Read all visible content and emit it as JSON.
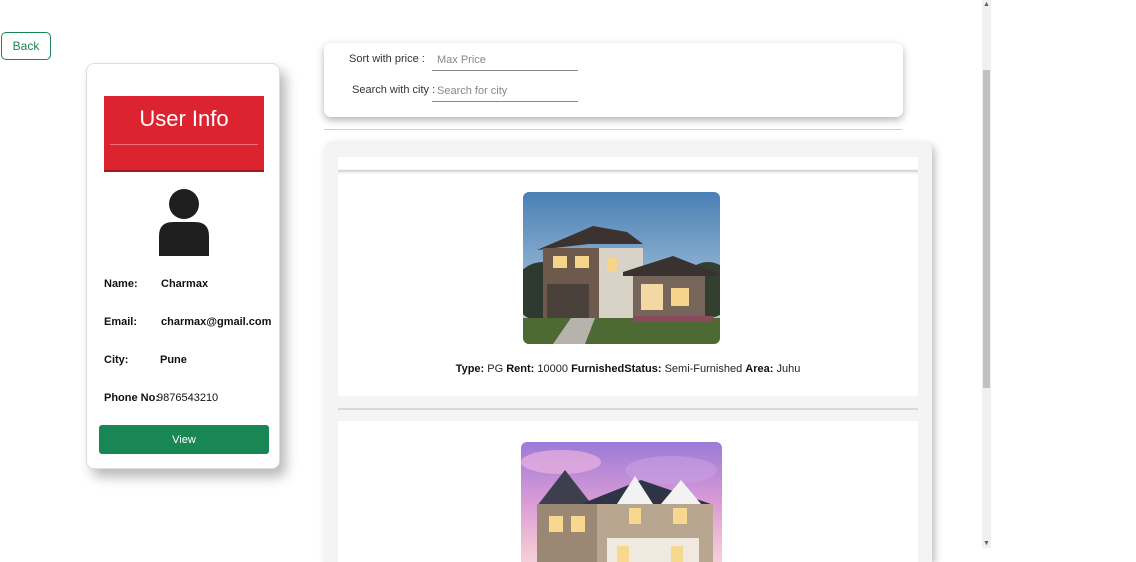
{
  "back_button": {
    "label": "Back"
  },
  "user_card": {
    "title": "User Info",
    "fields": [
      {
        "label": "Name:",
        "value": "Charmax"
      },
      {
        "label": "Email:",
        "value": "charmax@gmail.com"
      },
      {
        "label": "City:",
        "value": "Pune"
      },
      {
        "label": "Phone No:",
        "value": "9876543210"
      }
    ],
    "view_button": "View"
  },
  "filters": {
    "price_label": "Sort with price :",
    "price_placeholder": "Max Price",
    "city_label": "Search with city :",
    "city_placeholder": "Search for city"
  },
  "listings": [
    {
      "type_label": "Type:",
      "type": "PG",
      "rent_label": "Rent:",
      "rent": "10000",
      "furnished_label": "FurnishedStatus:",
      "furnished": "Semi-Furnished",
      "area_label": "Area:",
      "area": "Juhu"
    },
    {}
  ],
  "colors": {
    "accent_red": "#dc2430",
    "accent_green": "#198754"
  },
  "icons": {
    "avatar": "user-silhouette-icon",
    "scroll_up": "arrow-up-icon",
    "scroll_down": "arrow-down-icon"
  }
}
